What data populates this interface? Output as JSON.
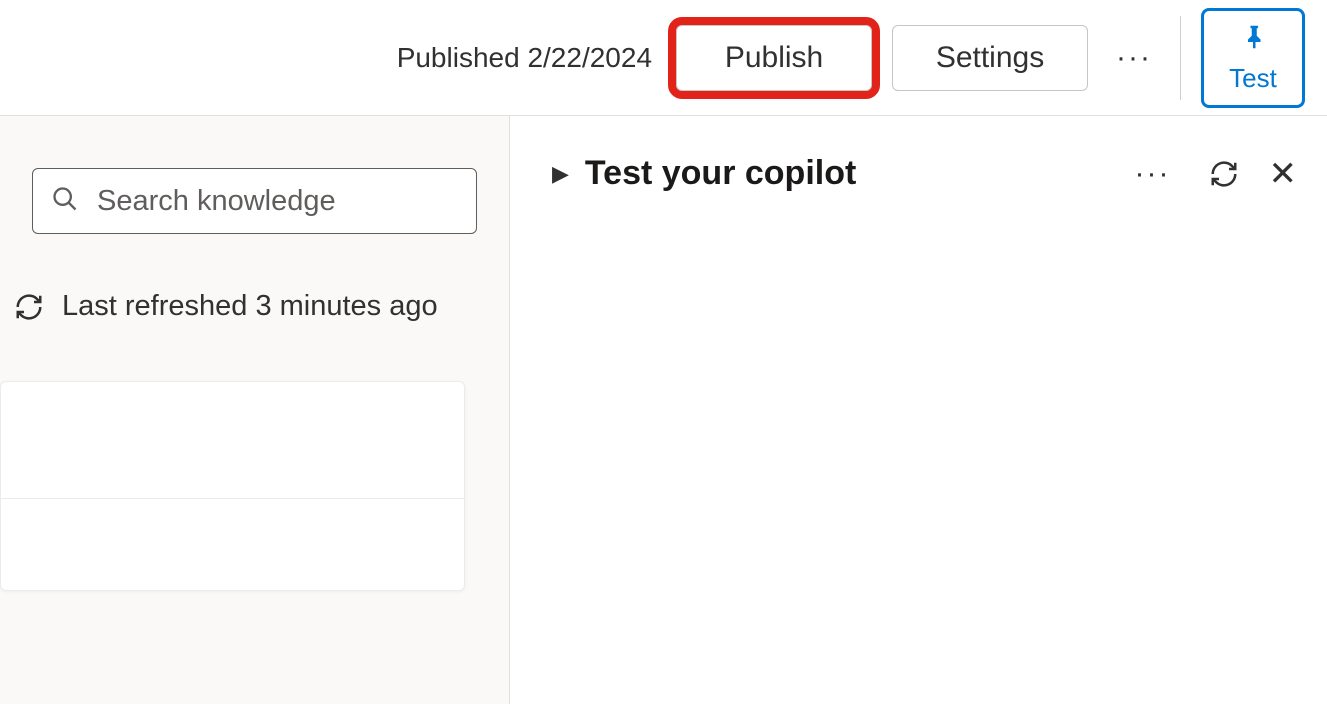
{
  "topbar": {
    "published_label": "Published 2/22/2024",
    "publish_label": "Publish",
    "settings_label": "Settings",
    "more_label": "···",
    "test_label": "Test"
  },
  "left": {
    "search_placeholder": "Search knowledge",
    "refresh_text": "Last refreshed 3 minutes ago"
  },
  "right": {
    "title": "Test your copilot",
    "more_label": "···"
  }
}
